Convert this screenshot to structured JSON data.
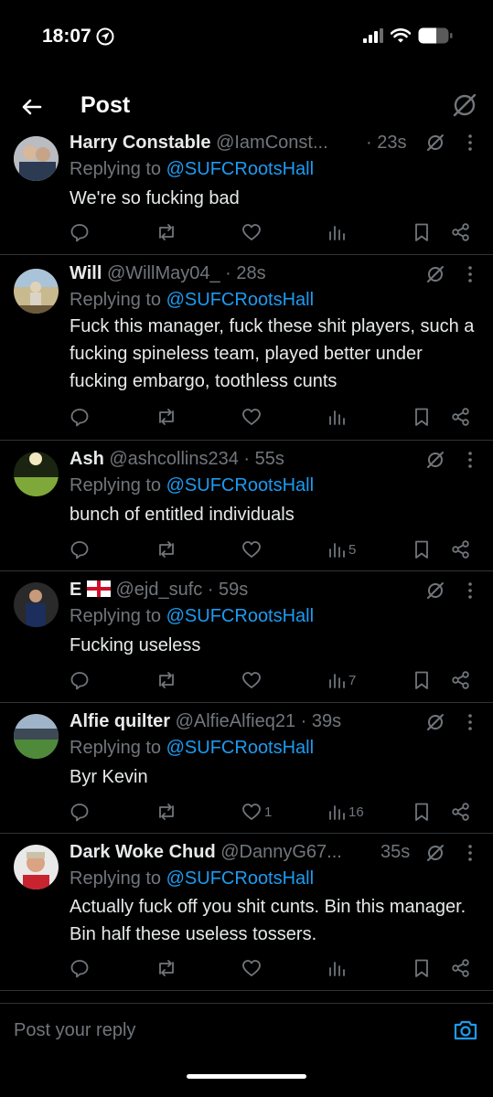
{
  "status": {
    "time": "18:07"
  },
  "header": {
    "title": "Post"
  },
  "tweets": [
    {
      "name": "Harry Constable",
      "handle": "@IamConst...",
      "time": "· 23s",
      "replying_prefix": "Replying to ",
      "replying_to": "@SUFCRootsHall",
      "text": "We're so fucking bad",
      "likes": "",
      "views": ""
    },
    {
      "name": "Will",
      "handle": "@WillMay04_",
      "time": "· 28s",
      "replying_prefix": "Replying to ",
      "replying_to": "@SUFCRootsHall",
      "text": "Fuck this manager, fuck these shit players, such a fucking spineless team, played better under fucking embargo, toothless cunts",
      "likes": "",
      "views": ""
    },
    {
      "name": "Ash",
      "handle": "@ashcollins234",
      "time": "· 55s",
      "replying_prefix": "Replying to ",
      "replying_to": "@SUFCRootsHall",
      "text": "bunch of entitled individuals",
      "likes": "",
      "views": "5"
    },
    {
      "name": "E",
      "flag": "england-flag",
      "handle": "@ejd_sufc",
      "time": "· 59s",
      "replying_prefix": "Replying to ",
      "replying_to": "@SUFCRootsHall",
      "text": "Fucking useless",
      "likes": "",
      "views": "7"
    },
    {
      "name": "Alfie quilter",
      "handle": "@AlfieAlfieq21",
      "time": "· 39s",
      "replying_prefix": "Replying to ",
      "replying_to": "@SUFCRootsHall",
      "text": "Byr Kevin",
      "likes": "1",
      "views": "16"
    },
    {
      "name": "Dark Woke Chud",
      "handle": "@DannyG67...",
      "time": "35s",
      "replying_prefix": "Replying to ",
      "replying_to": "@SUFCRootsHall",
      "text": "Actually fuck off you shit cunts. Bin this manager. Bin half these useless tossers.",
      "likes": "",
      "views": ""
    }
  ],
  "reply_bar": {
    "placeholder": "Post your reply"
  },
  "colors": {
    "background": "#000000",
    "text": "#e7e9ea",
    "muted": "#71767b",
    "accent": "#1d9bf0",
    "divider": "#2f3336"
  },
  "icons": [
    "back-arrow-icon",
    "grok-icon",
    "more-icon",
    "reply-icon",
    "retweet-icon",
    "like-icon",
    "views-icon",
    "bookmark-icon",
    "share-icon",
    "camera-icon",
    "signal-icon",
    "wifi-icon",
    "battery-icon",
    "location-icon"
  ]
}
